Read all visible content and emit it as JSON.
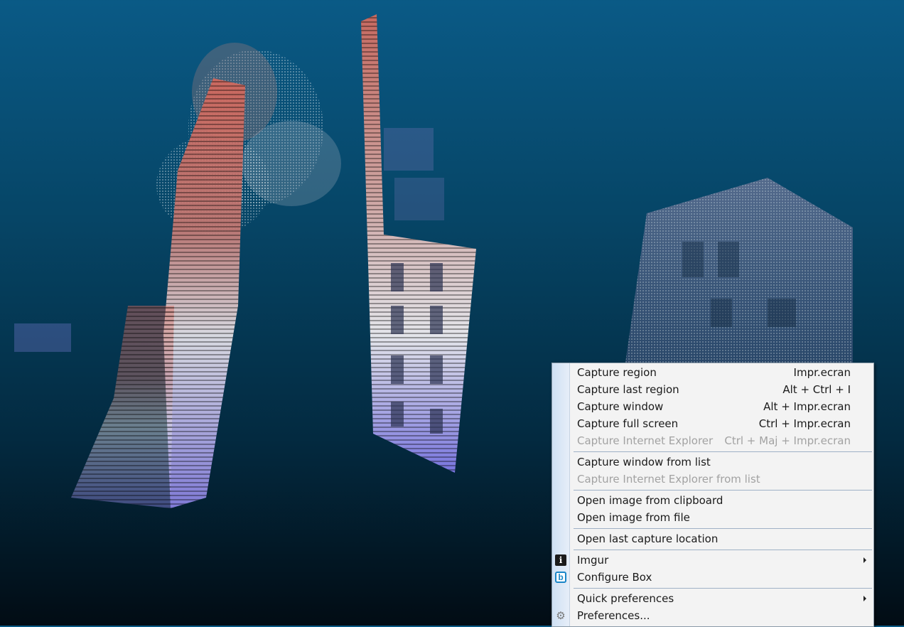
{
  "menu": {
    "items": [
      {
        "label": "Capture region",
        "shortcut": "Impr.ecran"
      },
      {
        "label": "Capture last region",
        "shortcut": "Alt + Ctrl + I"
      },
      {
        "label": "Capture window",
        "shortcut": "Alt + Impr.ecran"
      },
      {
        "label": "Capture full screen",
        "shortcut": "Ctrl + Impr.ecran"
      },
      {
        "label": "Capture Internet Explorer",
        "shortcut": "Ctrl + Maj + Impr.ecran",
        "disabled": true
      },
      {
        "label": "Capture window from list"
      },
      {
        "label": "Capture Internet Explorer from list",
        "disabled": true
      },
      {
        "label": "Open image from clipboard"
      },
      {
        "label": "Open image from file"
      },
      {
        "label": "Open last capture location"
      },
      {
        "label": "Imgur",
        "icon": "imgur-icon",
        "submenu": true
      },
      {
        "label": "Configure Box",
        "icon": "box-icon"
      },
      {
        "label": "Quick preferences",
        "submenu": true
      },
      {
        "label": "Preferences...",
        "icon": "gear-icon"
      }
    ]
  },
  "colors": {
    "background_top": "#0a5a86",
    "background_bottom": "#020c14",
    "point_high": "#e26a5c",
    "point_mid": "#f2f2f4",
    "point_low": "#7a74e0",
    "menu_bg": "#f3f3f3",
    "menu_disabled": "#a2a2a2"
  }
}
